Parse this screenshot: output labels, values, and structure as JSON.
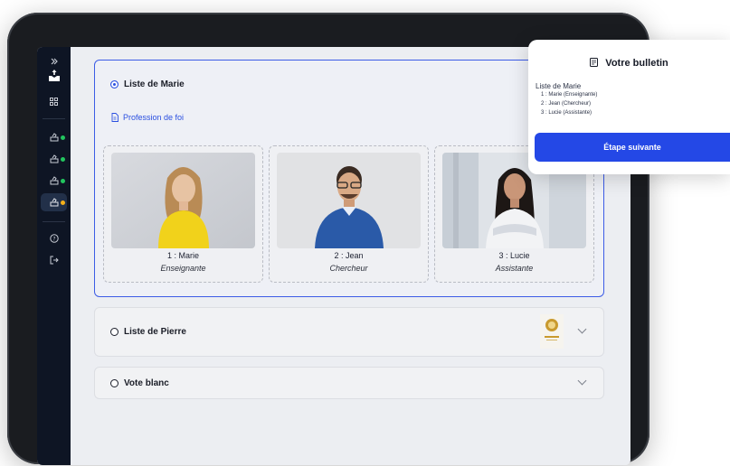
{
  "sidebar": {
    "expand_icon": "double-chevron-right",
    "items": [
      {
        "icon": "logo",
        "status": ""
      },
      {
        "icon": "grid",
        "status": ""
      },
      {
        "icon": "ballot-box",
        "status": "#22c55e"
      },
      {
        "icon": "ballot-box",
        "status": "#22c55e"
      },
      {
        "icon": "ballot-box",
        "status": "#22c55e"
      },
      {
        "icon": "ballot-box",
        "status": "#f5b019"
      },
      {
        "icon": "help",
        "status": ""
      },
      {
        "icon": "logout",
        "status": ""
      }
    ]
  },
  "lists": [
    {
      "title": "Liste de Marie",
      "selected": true,
      "link": "Profession de foi",
      "candidates": [
        {
          "name": "1 : Marie",
          "role": "Enseignante"
        },
        {
          "name": "2 : Jean",
          "role": "Chercheur"
        },
        {
          "name": "3 : Lucie",
          "role": "Assistante"
        }
      ]
    },
    {
      "title": "Liste de Pierre",
      "selected": false
    },
    {
      "title": "Vote blanc",
      "selected": false
    }
  ],
  "ballot": {
    "title": "Votre bulletin",
    "list_name": "Liste de Marie",
    "lines": [
      "1 : Marie (Enseignante)",
      "2 : Jean (Chercheur)",
      "3 : Lucie (Assistante)"
    ],
    "next_label": "Étape suivante"
  },
  "colors": {
    "accent": "#2448e6",
    "sidebar": "#0e1524"
  }
}
